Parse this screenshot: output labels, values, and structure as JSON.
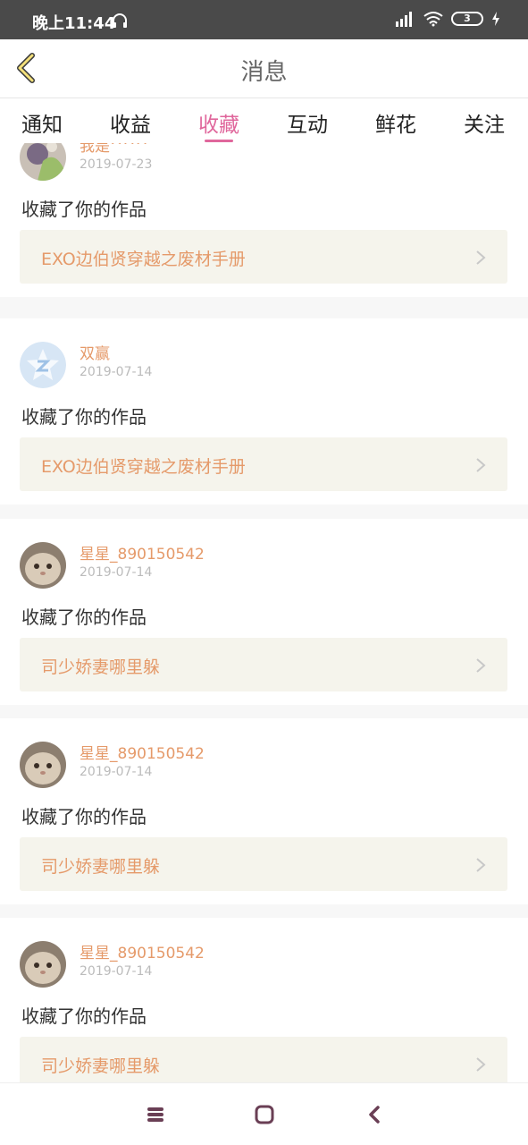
{
  "status": {
    "time": "晚上11:44",
    "battery": "3"
  },
  "header": {
    "title": "消息"
  },
  "tabs": [
    "通知",
    "收益",
    "收藏",
    "互动",
    "鲜花",
    "关注"
  ],
  "items": [
    {
      "user": "我是^^^",
      "date": "2019-07-23",
      "action": "收藏了你的作品",
      "work": "EXO边伯贤穿越之废材手册",
      "avatar": "avatar-1"
    },
    {
      "user": "双赢",
      "date": "2019-07-14",
      "action": "收藏了你的作品",
      "work": "EXO边伯贤穿越之废材手册",
      "avatar": "avatar-default"
    },
    {
      "user": "星星_890150542",
      "date": "2019-07-14",
      "action": "收藏了你的作品",
      "work": "司少娇妻哪里躲",
      "avatar": "avatar-cat"
    },
    {
      "user": "星星_890150542",
      "date": "2019-07-14",
      "action": "收藏了你的作品",
      "work": "司少娇妻哪里躲",
      "avatar": "avatar-cat"
    },
    {
      "user": "星星_890150542",
      "date": "2019-07-14",
      "action": "收藏了你的作品",
      "work": "司少娇妻哪里躲",
      "avatar": "avatar-cat"
    }
  ],
  "colors": {
    "accent": "#e0679c",
    "link": "#e59a6a",
    "statusbar": "#4a4a4a"
  }
}
